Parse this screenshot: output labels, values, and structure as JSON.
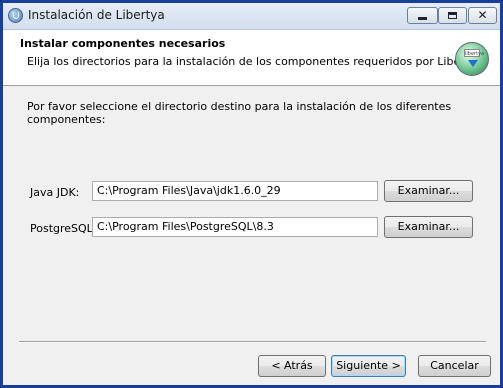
{
  "window": {
    "title": "Instalación de Libertya",
    "controls": {
      "minimize_icon": "minimize-icon",
      "maximize_icon": "maximize-icon",
      "close_glyph": "✕"
    }
  },
  "header": {
    "title": "Instalar componentes necesarios",
    "subtitle": "Elija los directorios para la instalación de los componentes requeridos por Libertya.",
    "logo_badge": "libertya"
  },
  "main": {
    "intro": "Por favor seleccione el directorio destino para la instalación de los diferentes componentes:",
    "java": {
      "label": "Java JDK:",
      "value": "C:\\Program Files\\Java\\jdk1.6.0_29",
      "browse_label": "Examinar..."
    },
    "postgres": {
      "label": "PostgreSQL:",
      "value": "C:\\Program Files\\PostgreSQL\\8.3",
      "browse_label": "Examinar..."
    }
  },
  "footer": {
    "back_label": "< Atrás",
    "next_label": "Siguiente >",
    "cancel_label": "Cancelar"
  },
  "colors": {
    "window_border": "#1a3f9a",
    "header_bg": "#ffffff",
    "body_bg": "#f0f0f0"
  }
}
